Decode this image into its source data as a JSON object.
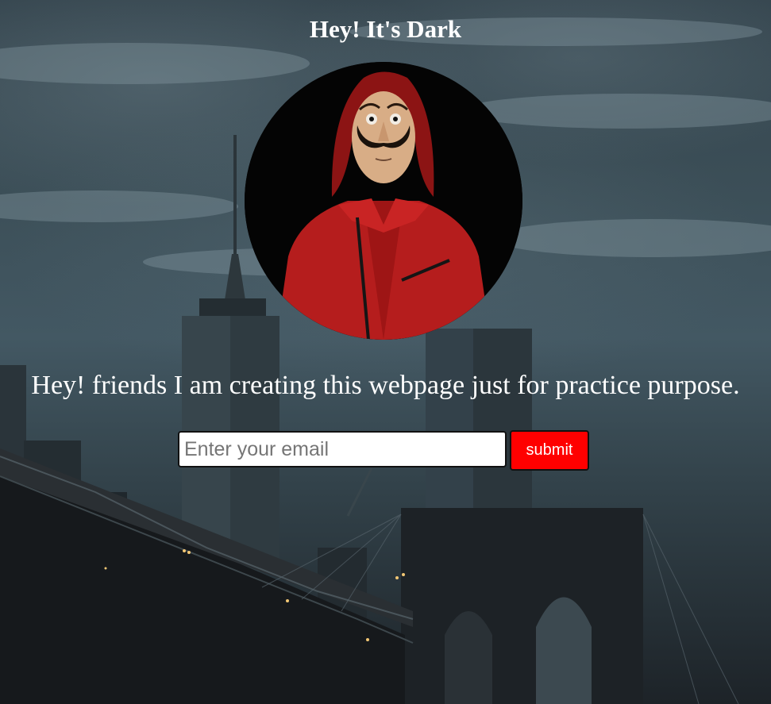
{
  "header": {
    "title": "Hey! It's Dark"
  },
  "avatar": {
    "icon": "masked-person-avatar"
  },
  "main": {
    "tagline": "Hey! friends I am creating this webpage just for practice purpose."
  },
  "form": {
    "email_placeholder": "Enter your email",
    "email_value": "",
    "submit_label": "submit"
  },
  "colors": {
    "submit_background": "#ff0000",
    "text": "#ffffff"
  }
}
